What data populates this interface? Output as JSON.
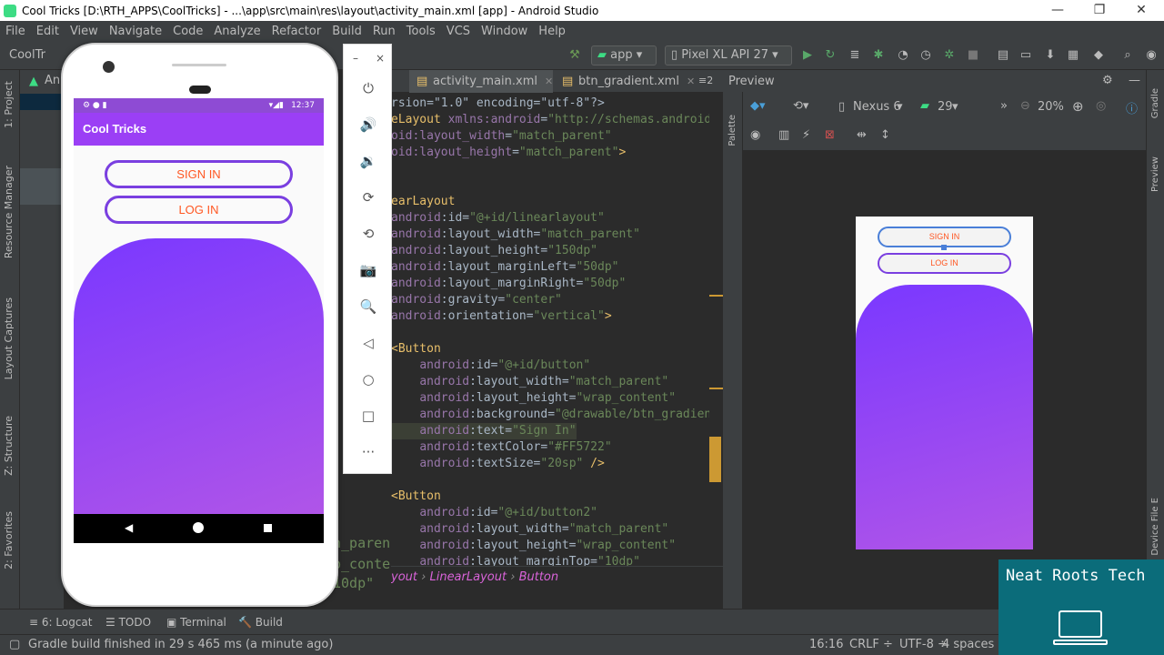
{
  "window": {
    "title": "Cool Tricks [D:\\RTH_APPS\\CoolTricks] - ...\\app\\src\\main\\res\\layout\\activity_main.xml [app] - Android Studio",
    "controls": [
      "—",
      "❐",
      "✕"
    ]
  },
  "menu": [
    "File",
    "Edit",
    "View",
    "Navigate",
    "Code",
    "Analyze",
    "Refactor",
    "Build",
    "Run",
    "Tools",
    "VCS",
    "Window",
    "Help"
  ],
  "toolbar": {
    "project_crumb": "CoolTr",
    "run_config": "app",
    "device": "Pixel XL API 27"
  },
  "left_stripe": [
    "1: Project",
    "Resource Manager",
    "Layout Captures",
    "Z: Structure",
    "2: Favorites"
  ],
  "project_panel": {
    "label": "An"
  },
  "tabs": [
    {
      "label": "activity_main.xml"
    },
    {
      "label": "btn_gradient.xml"
    }
  ],
  "tabs_overflow": "≡2",
  "editor": {
    "lines": [
      {
        "parts": [
          [
            "plain",
            "rsion=\"1.0\" encoding=\"utf-8\"?>"
          ]
        ]
      },
      {
        "parts": [
          [
            "tag",
            "eLayout "
          ],
          [
            "attr",
            "xmlns:android"
          ],
          [
            "plain",
            "="
          ],
          [
            "val",
            "\"http://schemas.android."
          ]
        ]
      },
      {
        "parts": [
          [
            "attr",
            "oid:layout_width"
          ],
          [
            "plain",
            "="
          ],
          [
            "val",
            "\"match_parent\""
          ]
        ]
      },
      {
        "parts": [
          [
            "attr",
            "oid:layout_height"
          ],
          [
            "plain",
            "="
          ],
          [
            "val",
            "\"match_parent\""
          ],
          [
            "tag",
            ">"
          ]
        ]
      },
      {
        "parts": []
      },
      {
        "parts": []
      },
      {
        "parts": [
          [
            "tag",
            "earLayout"
          ]
        ]
      },
      {
        "parts": [
          [
            "attr",
            "android"
          ],
          [
            "plain",
            ":id="
          ],
          [
            "val",
            "\"@+id/linearlayout\""
          ]
        ]
      },
      {
        "parts": [
          [
            "attr",
            "android"
          ],
          [
            "plain",
            ":layout_width="
          ],
          [
            "val",
            "\"match_parent\""
          ]
        ]
      },
      {
        "parts": [
          [
            "attr",
            "android"
          ],
          [
            "plain",
            ":layout_height="
          ],
          [
            "val",
            "\"150dp\""
          ]
        ]
      },
      {
        "parts": [
          [
            "attr",
            "android"
          ],
          [
            "plain",
            ":layout_marginLeft="
          ],
          [
            "val",
            "\"50dp\""
          ]
        ]
      },
      {
        "parts": [
          [
            "attr",
            "android"
          ],
          [
            "plain",
            ":layout_marginRight="
          ],
          [
            "val",
            "\"50dp\""
          ]
        ]
      },
      {
        "parts": [
          [
            "attr",
            "android"
          ],
          [
            "plain",
            ":gravity="
          ],
          [
            "val",
            "\"center\""
          ]
        ]
      },
      {
        "parts": [
          [
            "attr",
            "android"
          ],
          [
            "plain",
            ":orientation="
          ],
          [
            "val",
            "\"vertical\""
          ],
          [
            "tag",
            ">"
          ]
        ]
      },
      {
        "parts": []
      },
      {
        "parts": [
          [
            "tag",
            "<Button"
          ]
        ]
      },
      {
        "parts": [
          [
            "plain",
            "    "
          ],
          [
            "attr",
            "android"
          ],
          [
            "plain",
            ":id="
          ],
          [
            "val",
            "\"@+id/button\""
          ]
        ]
      },
      {
        "parts": [
          [
            "plain",
            "    "
          ],
          [
            "attr",
            "android"
          ],
          [
            "plain",
            ":layout_width="
          ],
          [
            "val",
            "\"match_parent\""
          ]
        ]
      },
      {
        "parts": [
          [
            "plain",
            "    "
          ],
          [
            "attr",
            "android"
          ],
          [
            "plain",
            ":layout_height="
          ],
          [
            "val",
            "\"wrap_content\""
          ]
        ]
      },
      {
        "parts": [
          [
            "plain",
            "    "
          ],
          [
            "attr",
            "android"
          ],
          [
            "plain",
            ":background="
          ],
          [
            "val",
            "\"@drawable/btn_gradient"
          ]
        ]
      },
      {
        "parts": [
          [
            "plain",
            "    "
          ],
          [
            "attr",
            "android"
          ],
          [
            "plain",
            ":text="
          ],
          [
            "val",
            "\"Sign In\""
          ]
        ],
        "highlight": true
      },
      {
        "parts": [
          [
            "plain",
            "    "
          ],
          [
            "attr",
            "android"
          ],
          [
            "plain",
            ":textColor="
          ],
          [
            "val",
            "\"#FF5722\""
          ]
        ]
      },
      {
        "parts": [
          [
            "plain",
            "    "
          ],
          [
            "attr",
            "android"
          ],
          [
            "plain",
            ":textSize="
          ],
          [
            "val",
            "\"20sp\""
          ],
          [
            "tag",
            " />"
          ]
        ]
      },
      {
        "parts": []
      },
      {
        "parts": [
          [
            "tag",
            "<Button"
          ]
        ]
      },
      {
        "parts": [
          [
            "plain",
            "    "
          ],
          [
            "attr",
            "android"
          ],
          [
            "plain",
            ":id="
          ],
          [
            "val",
            "\"@+id/button2\""
          ]
        ]
      },
      {
        "parts": [
          [
            "plain",
            "    "
          ],
          [
            "attr",
            "android"
          ],
          [
            "plain",
            ":layout_width="
          ],
          [
            "val",
            "\"match_parent\""
          ]
        ]
      },
      {
        "parts": [
          [
            "plain",
            "    "
          ],
          [
            "attr",
            "android"
          ],
          [
            "plain",
            ":layout_height="
          ],
          [
            "val",
            "\"wrap_content\""
          ]
        ]
      },
      {
        "parts": [
          [
            "plain",
            "    "
          ],
          [
            "attr",
            "android"
          ],
          [
            "plain",
            ":layout_marginTop="
          ],
          [
            "val",
            "\"10dp\""
          ]
        ]
      }
    ],
    "behind_phone": [
      "n_paren",
      "p_conte",
      "10dp\""
    ]
  },
  "breadcrumb": [
    "yout",
    "LinearLayout",
    "Button"
  ],
  "emulator": {
    "time": "12:37",
    "app_title": "Cool Tricks",
    "sign_in": "SIGN IN",
    "log_in": "LOG IN",
    "controls": [
      "⏻",
      "🔊",
      "🔉",
      "⟳",
      "⟲",
      "📷",
      "🔍",
      "◁",
      "○",
      "□",
      "···"
    ],
    "window_controls": [
      "–",
      "×"
    ]
  },
  "preview": {
    "title": "Preview",
    "device": "Nexus 6",
    "api": "29",
    "zoom": "20%",
    "sign_in": "SIGN IN",
    "log_in": "LOG IN",
    "palette": "Palette"
  },
  "right_stripe": [
    "Gradle",
    "Preview",
    "Device File E"
  ],
  "bottom_tools": [
    {
      "icon": "≡",
      "label": "6: Logcat"
    },
    {
      "icon": "☰",
      "label": "TODO"
    },
    {
      "icon": "▣",
      "label": "Terminal"
    },
    {
      "icon": "🔨",
      "label": "Build"
    }
  ],
  "status": {
    "message": "Gradle build finished in 29 s 465 ms (a minute ago)",
    "position": "16:16",
    "line_sep": "CRLF ÷",
    "encoding": "UTF-8 ÷",
    "indent": "4 spaces ÷"
  },
  "watermark": {
    "text": "Neat Roots Tech"
  },
  "colors": {
    "accent_purple": "#9b3ff5",
    "button_text": "#ff5722",
    "gradient_start": "#7a38ff",
    "gradient_end": "#b055e8"
  }
}
